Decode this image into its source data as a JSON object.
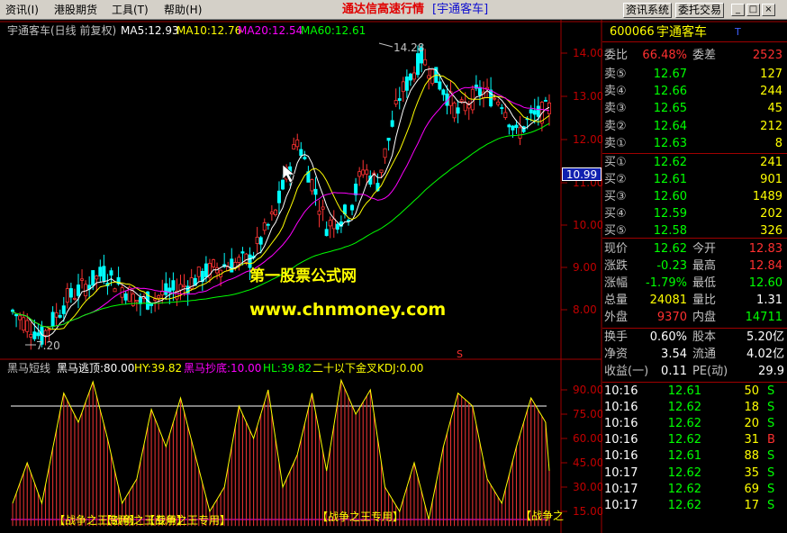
{
  "menu": {
    "items": [
      "资讯(I)",
      "港股期货",
      "工具(T)",
      "帮助(H)"
    ],
    "app_title": "通达信高速行情",
    "stock_tag": "[宇通客车]",
    "btn_news": "资讯系统",
    "btn_trade": "委托交易",
    "min_glyph": "_",
    "max_glyph": "□",
    "close_glyph": "×"
  },
  "chart": {
    "title": "宇通客车(日线 前复权)",
    "ma5": "MA5:12.93",
    "ma10": "MA10:12.76",
    "ma20": "MA20:12.54",
    "ma60": "MA60:12.61",
    "high_marker": "14.28",
    "low_marker": "7.20",
    "price_ticks": [
      "14.00",
      "13.00",
      "12.00",
      "11.00",
      "10.00",
      "9.00",
      "8.00"
    ],
    "cursor_price": "10.99",
    "watermark1": "第一股票公式网",
    "watermark2": "www.chnmoney.com",
    "signal": "S",
    "colors": {
      "up": "#ff3333",
      "down": "#00ffff",
      "ma5": "#ffffff",
      "ma10": "#ffff00",
      "ma20": "#ff00ff",
      "ma60": "#00ff00"
    }
  },
  "indicator": {
    "name": "黑马短线",
    "l1": "黑马逃顶:80.00",
    "l2": "HY:39.82",
    "l3": "黑马抄底:10.00",
    "l4": "HL:39.82",
    "l5": "二十以下金叉KDJ:0.00",
    "ticks": [
      "90.00",
      "75.00",
      "60.00",
      "45.00",
      "30.00",
      "15.00"
    ],
    "banners": [
      "【战争之王专用】",
      "【战争之王专用】",
      "【战争之王专用】",
      "【战争之王专用】",
      "【战争之"
    ]
  },
  "quote": {
    "code": "600066",
    "name": "宇通客车",
    "ratio_label": "委比",
    "ratio": "66.48%",
    "diff_label": "委差",
    "diff": "2523",
    "sells": [
      {
        "label": "卖⑤",
        "price": "12.67",
        "vol": "127"
      },
      {
        "label": "卖④",
        "price": "12.66",
        "vol": "244"
      },
      {
        "label": "卖③",
        "price": "12.65",
        "vol": "45"
      },
      {
        "label": "卖②",
        "price": "12.64",
        "vol": "212"
      },
      {
        "label": "卖①",
        "price": "12.63",
        "vol": "8"
      }
    ],
    "buys": [
      {
        "label": "买①",
        "price": "12.62",
        "vol": "241"
      },
      {
        "label": "买②",
        "price": "12.61",
        "vol": "901"
      },
      {
        "label": "买③",
        "price": "12.60",
        "vol": "1489"
      },
      {
        "label": "买④",
        "price": "12.59",
        "vol": "202"
      },
      {
        "label": "买⑤",
        "price": "12.58",
        "vol": "326"
      }
    ],
    "stats": [
      {
        "l1": "现价",
        "v1": "12.62",
        "l2": "今开",
        "v2": "12.83"
      },
      {
        "l1": "涨跌",
        "v1": "-0.23",
        "l2": "最高",
        "v2": "12.84"
      },
      {
        "l1": "涨幅",
        "v1": "-1.79%",
        "l2": "最低",
        "v2": "12.60"
      },
      {
        "l1": "总量",
        "v1": "24081",
        "l2": "量比",
        "v2": "1.31"
      },
      {
        "l1": "外盘",
        "v1": "9370",
        "l2": "内盘",
        "v2": "14711"
      }
    ],
    "fund": [
      {
        "l1": "换手",
        "v1": "0.60%",
        "l2": "股本",
        "v2": "5.20亿"
      },
      {
        "l1": "净资",
        "v1": "3.54",
        "l2": "流通",
        "v2": "4.02亿"
      },
      {
        "l1": "收益(一)",
        "v1": "0.11",
        "l2": "PE(动)",
        "v2": "29.9"
      }
    ],
    "ticks": [
      {
        "time": "10:16",
        "price": "12.61",
        "vol": "50",
        "side": "S"
      },
      {
        "time": "10:16",
        "price": "12.62",
        "vol": "18",
        "side": "S"
      },
      {
        "time": "10:16",
        "price": "12.62",
        "vol": "20",
        "side": "S"
      },
      {
        "time": "10:16",
        "price": "12.62",
        "vol": "31",
        "side": "B"
      },
      {
        "time": "10:16",
        "price": "12.61",
        "vol": "88",
        "side": "S"
      },
      {
        "time": "10:17",
        "price": "12.62",
        "vol": "35",
        "side": "S"
      },
      {
        "time": "10:17",
        "price": "12.62",
        "vol": "69",
        "side": "S"
      },
      {
        "time": "10:17",
        "price": "12.62",
        "vol": "17",
        "side": "S"
      }
    ]
  }
}
